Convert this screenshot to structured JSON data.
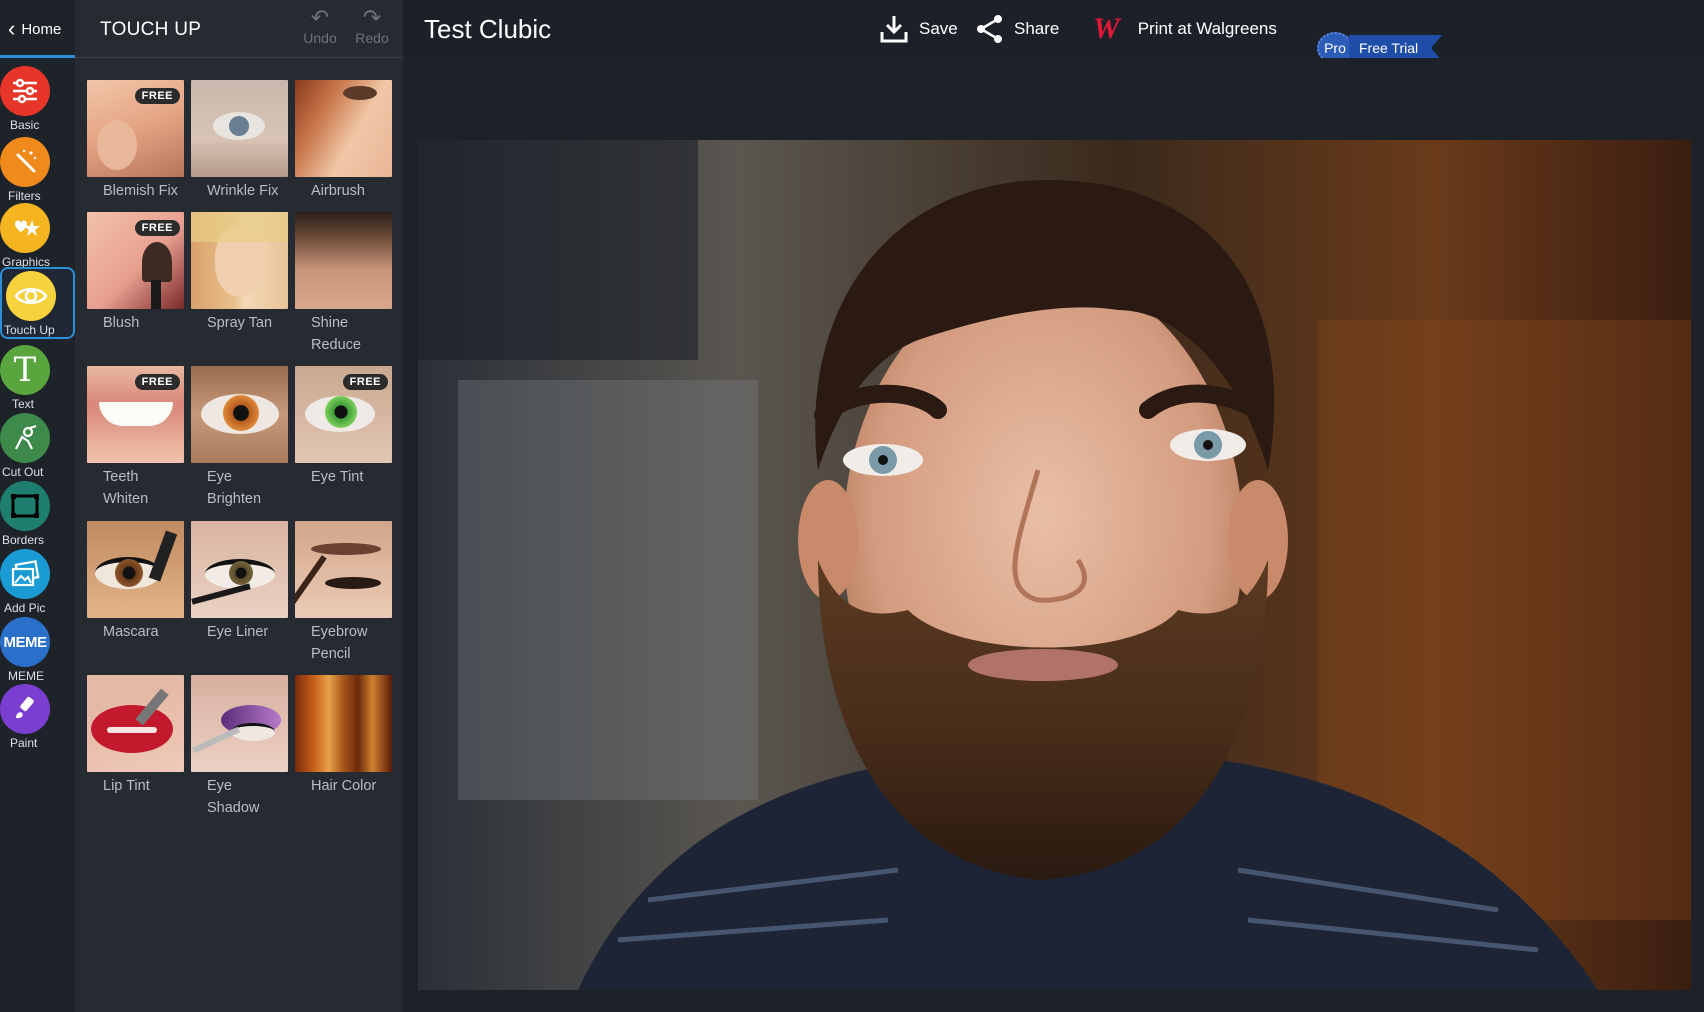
{
  "rail": {
    "home_label": "Home",
    "items": [
      {
        "label": "Basic",
        "color": "#e8352a",
        "icon": "sliders-icon"
      },
      {
        "label": "Filters",
        "color": "#f08a1c",
        "icon": "magic-wand-icon"
      },
      {
        "label": "Graphics",
        "color": "#f4b521",
        "icon": "hearts-star-icon"
      },
      {
        "label": "Touch Up",
        "color": "#f6d33c",
        "icon": "eye-icon"
      },
      {
        "label": "Text",
        "color": "#5aa63e",
        "icon": "text-t-icon"
      },
      {
        "label": "Cut Out",
        "color": "#3d8a4a",
        "icon": "cutout-icon"
      },
      {
        "label": "Borders",
        "color": "#1f7f6f",
        "icon": "frame-icon"
      },
      {
        "label": "Add Pic",
        "color": "#1a9bd4",
        "icon": "add-picture-icon"
      },
      {
        "label": "MEME",
        "color": "#2a6fc9",
        "icon": "meme-icon"
      },
      {
        "label": "Paint",
        "color": "#7a3fd0",
        "icon": "brush-icon"
      }
    ]
  },
  "panel": {
    "title": "TOUCH UP",
    "undo_label": "Undo",
    "redo_label": "Redo",
    "free_badge": "FREE",
    "tools": [
      {
        "name": "Blemish Fix",
        "free": true
      },
      {
        "name": "Wrinkle Fix",
        "free": false
      },
      {
        "name": "Airbrush",
        "free": false
      },
      {
        "name": "Blush",
        "free": true
      },
      {
        "name": "Spray Tan",
        "free": false
      },
      {
        "name": "Shine Reduce",
        "free": false
      },
      {
        "name": "Teeth Whiten",
        "free": true
      },
      {
        "name": "Eye Brighten",
        "free": false
      },
      {
        "name": "Eye Tint",
        "free": true
      },
      {
        "name": "Mascara",
        "free": false
      },
      {
        "name": "Eye Liner",
        "free": false
      },
      {
        "name": "Eyebrow Pencil",
        "free": false
      },
      {
        "name": "Lip Tint",
        "free": false
      },
      {
        "name": "Eye Shadow",
        "free": false
      },
      {
        "name": "Hair Color",
        "free": false
      }
    ]
  },
  "topbar": {
    "doc_title": "Test Clubic",
    "save_label": "Save",
    "share_label": "Share",
    "walgreens_logo": "W",
    "print_label": "Print at Walgreens",
    "pro_label": "Pro",
    "trial_label": "Free Trial"
  },
  "colors": {
    "accent": "#2a8fd8",
    "walgreens": "#e31837",
    "pro": "#1f4ea8"
  }
}
